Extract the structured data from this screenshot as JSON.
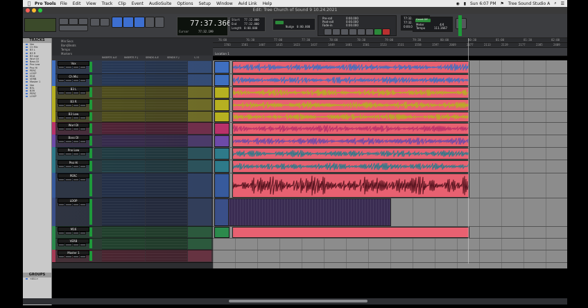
{
  "menubar": {
    "app_name": "Pro Tools",
    "items": [
      "File",
      "Edit",
      "View",
      "Track",
      "Clip",
      "Event",
      "AudioSuite",
      "Options",
      "Setup",
      "Window",
      "Avid Link",
      "Help"
    ],
    "clock": "Sun 6:07 PM",
    "user": "Tree Sound Studio A"
  },
  "window": {
    "title": "Edit: Tree Church of Sound 9 10.24.2021"
  },
  "counter": {
    "main": "77:37.366",
    "cursor_label": "Cursor",
    "cursor_value": "77:32.199"
  },
  "selection": {
    "start_label": "Start",
    "end_label": "End",
    "length_label": "Length",
    "start": "77:32.000",
    "end": "77:32.000",
    "length": "0:00.000"
  },
  "nudge": {
    "label": "Nudge",
    "value": "0:00.000"
  },
  "prepost": {
    "preroll_label": "Pre-roll",
    "postroll_label": "Post-roll",
    "fadein_label": "Fade-in",
    "preroll": "0:00.000",
    "postroll": "0:00.000",
    "fadein": "0:00.000"
  },
  "transport_right": {
    "start": "77:32.000",
    "end": "77:32.000",
    "length": "0:00.000",
    "meter_label": "Meter",
    "tempo_label": "Tempo",
    "meter": "4/4",
    "tempo": "111.1667",
    "click_label": "Count Off"
  },
  "ruler_labels": [
    "Min:Secs",
    "Bars|Beats",
    "Tempo",
    "Markers"
  ],
  "ruler_ticks": [
    "76:00",
    "76:30",
    "77:00",
    "77:30",
    "78:00",
    "78:30",
    "79:00",
    "79:30",
    "80:00",
    "80:30",
    "81:00",
    "81:30",
    "82:00"
  ],
  "ruler_bars": [
    "1703",
    "1581",
    "1407",
    "1415",
    "1423",
    "1437",
    "1449",
    "1481",
    "1501",
    "1523",
    "1531",
    "1558",
    "1597",
    "2069",
    "2077",
    "2113",
    "2119",
    "2177",
    "2385",
    "2409"
  ],
  "location_label": "Location 1",
  "sidebar": {
    "tracks_header": "TRACKS",
    "groups_header": "GROUPS",
    "groups_items": [
      "<ALL>"
    ],
    "track_list": [
      "Vox",
      "Ch Mic",
      "B3 L",
      "B3 R",
      "B3 Low",
      "Wurl DI",
      "Bass DI",
      "Pno Low",
      "Pno Hi",
      "PERC",
      "LOOP",
      "M16",
      "VERB",
      "Master 1",
      "Vox",
      "B3L",
      "B3R",
      "PERC",
      "LOOP"
    ]
  },
  "mix_headers": {
    "inserts_ae": "INSERTS A-E",
    "inserts_fj": "INSERTS F-J",
    "sends_ae": "SENDS A-E",
    "sends_fj": "SENDS F-J",
    "io": "I / O"
  },
  "tracks": [
    {
      "name": "Vox",
      "color": "#3f6fc0"
    },
    {
      "name": "Ch Mic",
      "color": "#3f6fc0"
    },
    {
      "name": "B3 L",
      "color": "#b6b021"
    },
    {
      "name": "B3 R",
      "color": "#b6b021"
    },
    {
      "name": "B3 Low",
      "color": "#b6b021"
    },
    {
      "name": "Wurl DI",
      "color": "#b8326a"
    },
    {
      "name": "Bass DI",
      "color": "#6d4aa8"
    },
    {
      "name": "Pno Low",
      "color": "#2e7a8a"
    },
    {
      "name": "Pno Hi",
      "color": "#2e7a8a"
    },
    {
      "name": "PERC",
      "color": "#375a9c"
    },
    {
      "name": "LOOP",
      "color": "#3a4f88"
    },
    {
      "name": "M16",
      "color": "#2c8a4c"
    },
    {
      "name": "VERB",
      "color": "#2c8a4c"
    },
    {
      "name": "Master 1",
      "color": "#a63a55"
    }
  ],
  "colors": {
    "region": "#e86171",
    "loop_region": "#3a2c52",
    "accent": "#3d6fd0"
  }
}
